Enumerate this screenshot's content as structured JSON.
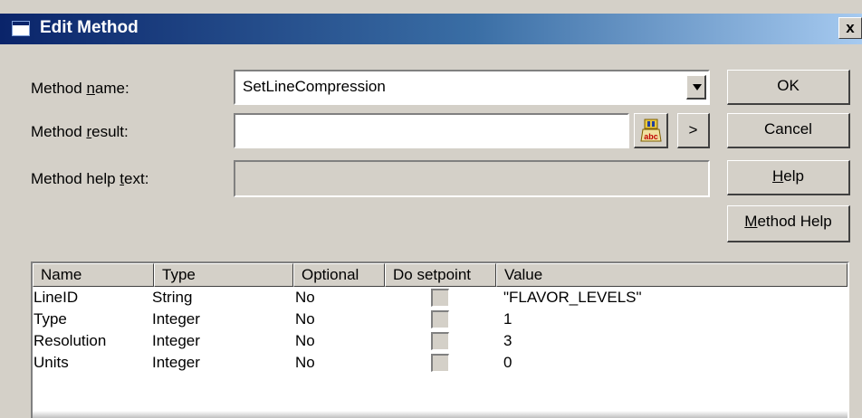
{
  "window": {
    "title": "Edit Method",
    "close_label": "x"
  },
  "form": {
    "method_name_label_pre": "Method ",
    "method_name_label_key": "n",
    "method_name_label_post": "ame:",
    "method_name_value": "SetLineCompression",
    "method_result_label_pre": "Method ",
    "method_result_label_key": "r",
    "method_result_label_post": "esult:",
    "method_result_value": "",
    "help_text_label_pre": "Method help ",
    "help_text_label_key": "t",
    "help_text_label_post": "ext:",
    "help_text_value": "",
    "arrow_button_label": ">"
  },
  "buttons": {
    "ok": "OK",
    "cancel": "Cancel",
    "help_key": "H",
    "help_rest": "elp",
    "method_help_key": "M",
    "method_help_rest": "ethod Help"
  },
  "table": {
    "columns": [
      "Name",
      "Type",
      "Optional",
      "Do setpoint",
      "Value"
    ],
    "rows": [
      {
        "name": "LineID",
        "type": "String",
        "optional": "No",
        "do_setpoint": false,
        "value": "\"FLAVOR_LEVELS\""
      },
      {
        "name": "Type",
        "type": "Integer",
        "optional": "No",
        "do_setpoint": false,
        "value": "1"
      },
      {
        "name": "Resolution",
        "type": "Integer",
        "optional": "No",
        "do_setpoint": false,
        "value": "3"
      },
      {
        "name": "Units",
        "type": "Integer",
        "optional": "No",
        "do_setpoint": false,
        "value": "0"
      }
    ]
  },
  "colors": {
    "titlebar_start": "#0a246a",
    "titlebar_end": "#a6caf0",
    "dialog_bg": "#d4d0c8"
  }
}
